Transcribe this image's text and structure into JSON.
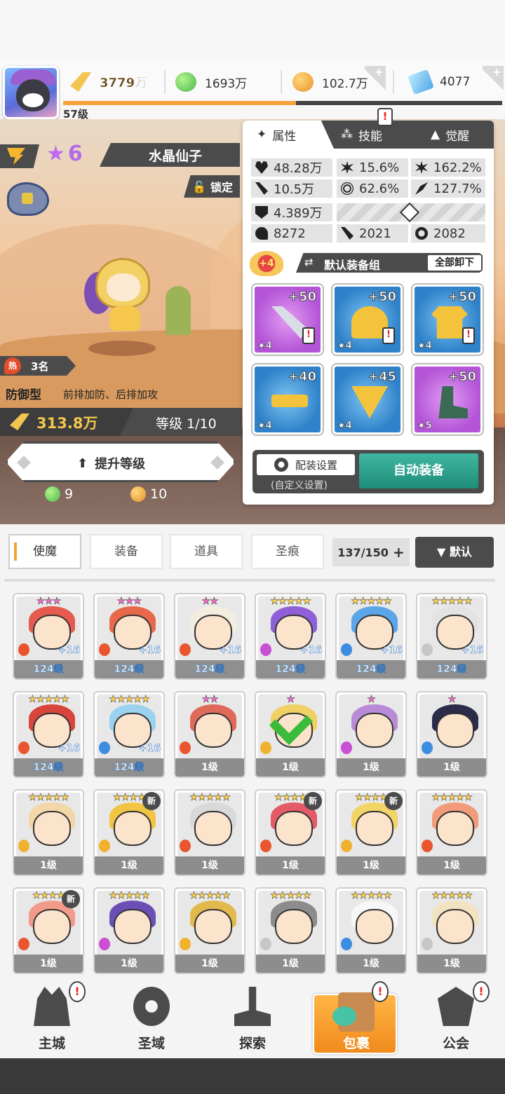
{
  "resources": {
    "player_level": "57级",
    "power": "3779万",
    "green_currency": "1693万",
    "orange_currency": "102.7万",
    "gems": "4077",
    "xp_fraction": 0.53
  },
  "hero": {
    "star_level": "6",
    "name": "水晶仙子",
    "lock_label": "锁定",
    "hot_rank": "3名",
    "hot_icon": "热",
    "role_type": "防御型",
    "role_desc": "前排加防、后排加攻",
    "power": "313.8万",
    "level_text": "等级 1/10",
    "upgrade_label": "提升等级",
    "cost_green": "9",
    "cost_orange": "10"
  },
  "panel": {
    "tabs": [
      {
        "label": "属性",
        "icon": "attribute-icon"
      },
      {
        "label": "技能",
        "icon": "skill-icon"
      },
      {
        "label": "觉醒",
        "icon": "awaken-icon"
      }
    ],
    "stats": {
      "hp": "48.28万",
      "crit": "15.6%",
      "crit_dmg": "162.2%",
      "atk": "10.5万",
      "accuracy": "62.6%",
      "speed_pct": "127.7%",
      "def": "4.389万",
      "stat_a": "8272",
      "stat_b": "2021",
      "stat_c": "2082"
    },
    "gear_badge": "+4",
    "gear_set_name": "默认装备组",
    "unload_all": "全部卸下",
    "gear": [
      {
        "plus": "+50",
        "stars": "★4",
        "item": "sword",
        "rarity": "purple",
        "warn": "!"
      },
      {
        "plus": "+50",
        "stars": "★4",
        "item": "helm",
        "rarity": "blue",
        "warn": "!"
      },
      {
        "plus": "+50",
        "stars": "★4",
        "item": "armor",
        "rarity": "blue",
        "warn": "!"
      },
      {
        "plus": "+40",
        "stars": "★4",
        "item": "belt",
        "rarity": "blue",
        "warn": ""
      },
      {
        "plus": "+45",
        "stars": "★4",
        "item": "neck",
        "rarity": "blue",
        "warn": ""
      },
      {
        "plus": "+50",
        "stars": "★5",
        "item": "boot",
        "rarity": "purple",
        "warn": ""
      }
    ],
    "config_label": "配装设置",
    "config_sub": "(自定义设置)",
    "auto_equip": "自动装备"
  },
  "inventory": {
    "tabs": [
      "使魔",
      "装备",
      "道具",
      "圣痕"
    ],
    "count": "137/150",
    "sort_label": "▼ 默认",
    "cards": [
      {
        "stars": "★★★",
        "star_color": "pink",
        "hair": "#e65a4f",
        "bg": "#e8e8e8",
        "elem": "#e8552e",
        "plus": "+16",
        "level": "124级",
        "lv_blue": true
      },
      {
        "stars": "★★★",
        "star_color": "pink",
        "hair": "#e8694a",
        "bg": "#e8e8e8",
        "elem": "#e8552e",
        "plus": "+16",
        "level": "124级",
        "lv_blue": true
      },
      {
        "stars": "★★",
        "star_color": "pink",
        "hair": "#f3ede0",
        "bg": "#e8e8e8",
        "elem": "#e8552e",
        "plus": "+16",
        "level": "124级",
        "lv_blue": true
      },
      {
        "stars": "★★★★★",
        "star_color": "gold",
        "hair": "#8e5fd6",
        "bg": "#e8e8e8",
        "elem": "#c94fd3",
        "plus": "+16",
        "level": "124级",
        "lv_blue": true
      },
      {
        "stars": "★★★★★",
        "star_color": "gold",
        "hair": "#5aa6e8",
        "bg": "#e8e8e8",
        "elem": "#3c8de0",
        "plus": "+16",
        "level": "124级",
        "lv_blue": true
      },
      {
        "stars": "★★★★★",
        "star_color": "gold",
        "hair": "#e3e3e3",
        "bg": "#e8e8e8",
        "elem": "#c6c6c6",
        "plus": "+16",
        "level": "124级",
        "lv_blue": true
      },
      {
        "stars": "★★★★★",
        "star_color": "gold",
        "hair": "#d8453a",
        "bg": "#e8e8e8",
        "elem": "#e8552e",
        "plus": "+16",
        "level": "124级",
        "lv_blue": true
      },
      {
        "stars": "★★★★★",
        "star_color": "gold",
        "hair": "#9ad2ef",
        "bg": "#e8e8e8",
        "elem": "#3c8de0",
        "plus": "+16",
        "level": "124级",
        "lv_blue": true
      },
      {
        "stars": "★★",
        "star_color": "pink",
        "hair": "#e06a5a",
        "bg": "#e8e8e8",
        "elem": "#e8552e",
        "plus": "",
        "level": "1级",
        "lv_blue": false
      },
      {
        "stars": "★",
        "star_color": "pink",
        "hair": "#f0cf63",
        "bg": "#e8e8e8",
        "elem": "#f0b22e",
        "plus": "",
        "level": "1级",
        "lv_blue": false,
        "check": true
      },
      {
        "stars": "★",
        "star_color": "pink",
        "hair": "#b98bd6",
        "bg": "#e8e8e8",
        "elem": "#c94fd3",
        "plus": "",
        "level": "1级",
        "lv_blue": false
      },
      {
        "stars": "★",
        "star_color": "pink",
        "hair": "#2b2b4a",
        "bg": "#e8e8e8",
        "elem": "#3c8de0",
        "plus": "",
        "level": "1级",
        "lv_blue": false
      },
      {
        "stars": "★★★★★",
        "star_color": "gold",
        "hair": "#f3d7a8",
        "bg": "#e8e8e8",
        "elem": "#f0b22e",
        "plus": "",
        "level": "1级",
        "lv_blue": false
      },
      {
        "stars": "★★★★",
        "star_color": "gold",
        "hair": "#f2c443",
        "bg": "#e8e8e8",
        "elem": "#f0b22e",
        "plus": "",
        "level": "1级",
        "lv_blue": false,
        "new": "新"
      },
      {
        "stars": "★★★★★",
        "star_color": "gold",
        "hair": "#d9d9d9",
        "bg": "#e8e8e8",
        "elem": "#e8552e",
        "plus": "",
        "level": "1级",
        "lv_blue": false
      },
      {
        "stars": "★★★★",
        "star_color": "gold",
        "hair": "#e45a66",
        "bg": "#e8e8e8",
        "elem": "#e8552e",
        "plus": "",
        "level": "1级",
        "lv_blue": false,
        "new": "新"
      },
      {
        "stars": "★★★★",
        "star_color": "gold",
        "hair": "#f3d466",
        "bg": "#e8e8e8",
        "elem": "#f0b22e",
        "plus": "",
        "level": "1级",
        "lv_blue": false,
        "new": "新"
      },
      {
        "stars": "★★★★★",
        "star_color": "gold",
        "hair": "#f29b7b",
        "bg": "#e8e8e8",
        "elem": "#e8552e",
        "plus": "",
        "level": "1级",
        "lv_blue": false
      },
      {
        "stars": "★★★★",
        "star_color": "gold",
        "hair": "#f29b8b",
        "bg": "#e8e8e8",
        "elem": "#e8552e",
        "plus": "",
        "level": "1级",
        "lv_blue": false,
        "new": "新"
      },
      {
        "stars": "★★★★★",
        "star_color": "gold",
        "hair": "#6b4fb5",
        "bg": "#e8e8e8",
        "elem": "#c94fd3",
        "plus": "",
        "level": "1级",
        "lv_blue": false
      },
      {
        "stars": "★★★★★",
        "star_color": "gold",
        "hair": "#e2b94c",
        "bg": "#e8e8e8",
        "elem": "#f0b22e",
        "plus": "",
        "level": "1级",
        "lv_blue": false
      },
      {
        "stars": "★★★★★",
        "star_color": "gold",
        "hair": "#8c8c8c",
        "bg": "#e8e8e8",
        "elem": "#c6c6c6",
        "plus": "",
        "level": "1级",
        "lv_blue": false
      },
      {
        "stars": "★★★★★",
        "star_color": "gold",
        "hair": "#f7f7f7",
        "bg": "#e8e8e8",
        "elem": "#3c8de0",
        "plus": "",
        "level": "1级",
        "lv_blue": false
      },
      {
        "stars": "★★★★★",
        "star_color": "gold",
        "hair": "#f1e3c0",
        "bg": "#e8e8e8",
        "elem": "#c6c6c6",
        "plus": "",
        "level": "1级",
        "lv_blue": false
      }
    ]
  },
  "nav": [
    {
      "label": "主城",
      "icon": "castle",
      "badge": "!"
    },
    {
      "label": "圣域",
      "icon": "swirl",
      "badge": ""
    },
    {
      "label": "探索",
      "icon": "sword",
      "badge": ""
    },
    {
      "label": "包裹",
      "icon": "bag",
      "badge": "!",
      "active": true
    },
    {
      "label": "公会",
      "icon": "guild",
      "badge": "!"
    }
  ],
  "colors": {
    "accent_orange": "#f7a23c",
    "dark_ui": "#4b4b4b",
    "auto_equip_green": "#1f8c7a"
  }
}
